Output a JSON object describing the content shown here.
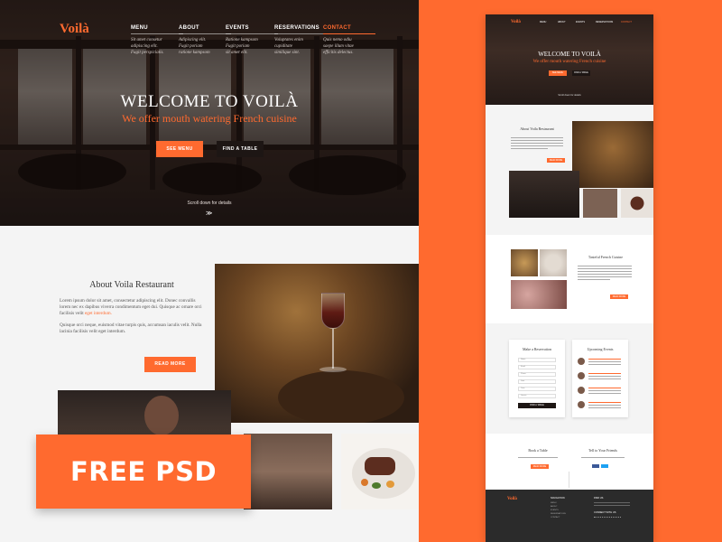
{
  "brand": {
    "logo": "Voilà",
    "accent": "#ff6a2f"
  },
  "nav": [
    {
      "label": "MENU",
      "desc": [
        "Sit amet consetur",
        "adipiscing elit.",
        "Fugit perspiciatis."
      ]
    },
    {
      "label": "ABOUT",
      "desc": [
        "Adipiscing elit.",
        "Fugit poriam",
        "ratione kampsom"
      ]
    },
    {
      "label": "EVENTS",
      "desc": [
        "Ratione kampsom",
        "Fugit poriam",
        "sit amet elit."
      ]
    },
    {
      "label": "RESERVATIONS",
      "desc": [
        "Voluptates enim",
        "cupiditate",
        "similique sint."
      ]
    },
    {
      "label": "CONTACT",
      "desc": [
        "Quis nemo odiu",
        "saepe illum vitae",
        "efficitis delectus."
      ]
    }
  ],
  "hero": {
    "title": "WELCOME TO VOILÀ",
    "subtitle": "We offer mouth watering French cuisine",
    "primary_button": "SEE MENU",
    "secondary_button": "FIND A TABLE",
    "scroll_hint": "Scroll down for details",
    "scroll_icon": "chevron-double-down-icon"
  },
  "about": {
    "title": "About Voila Restaurant",
    "p1_main": "Lorem ipsum dolor sit amet, consectetur adipiscing elit. Donec convallis lorem nec ex dapibus viverra condimentum eget dui. Quisque ac ornare orci facilisis velit ",
    "p1_link": "eget interdum.",
    "p2": "Quisque orci neque, euismod vitae turpis quis, accumsan iaculis velit. Nulla lacinia facilisis velit eget interdum.",
    "button": "READ MORE"
  },
  "promo": {
    "label": "FREE PSD"
  },
  "preview": {
    "logo": "Voilà",
    "nav": [
      "MENU",
      "ABOUT",
      "EVENTS",
      "RESERVATIONS",
      "CONTACT"
    ],
    "hero_title": "WELCOME TO VOILÀ",
    "hero_subtitle": "We offer mouth watering French cuisine",
    "scroll_hint": "Scroll down for details",
    "about_title": "About Voila Restaurant",
    "cuisine_title": "Tasteful French Cuisine",
    "reservation_title": "Make a Reservation",
    "reservation_fields": [
      "Name",
      "Email",
      "Phone",
      "Date",
      "Time",
      "Guests"
    ],
    "reservation_button": "FIND A TABLE",
    "events_title": "Upcoming Events",
    "book_title": "Book a Table",
    "friends_title": "Tell to Your Friends",
    "footer_logo": "Voilà",
    "footer_nav_title": "NAVIGATION",
    "footer_nav": [
      "MENU",
      "ABOUT",
      "EVENTS",
      "RESERVATIONS",
      "CONTACT"
    ],
    "footer_contact_title": "FIND US",
    "footer_connect_title": "CONNECT WITH US"
  }
}
